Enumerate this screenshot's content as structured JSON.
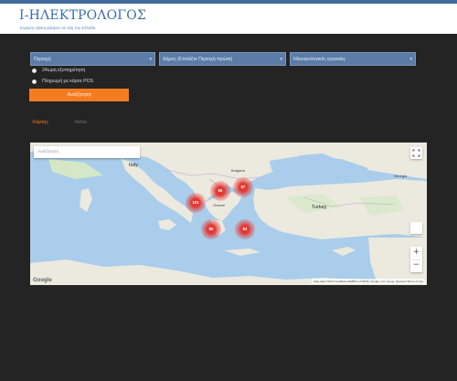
{
  "header": {
    "title": "I-ΗΛΕΚΤΡΟΛΟΓΟΣ",
    "subtitle": "Εύρεση ηλεκτρολόγου σε όλη την Ελλάδα"
  },
  "filters": [
    {
      "label": "Περιοχή"
    },
    {
      "label": "Δήμος (Επιλέξτε Περιοχή πρώτα)"
    },
    {
      "label": "Ηλεκτρολογικές εργασίες"
    }
  ],
  "options": [
    {
      "label": "24ωρη εξυπηρέτηση"
    },
    {
      "label": "Πληρωμή με κάρτα POS"
    }
  ],
  "search_button": "Αναζήτηση",
  "tabs": [
    {
      "label": "Χάρτης",
      "active": true
    },
    {
      "label": "Λίστα",
      "active": false
    }
  ],
  "map": {
    "search_placeholder": "Αναζήτηση",
    "google_logo": "Google",
    "attribution": "Map data ©2017 GeoBasis-DE/BKG (©2009), Google, Inst. Geogr. Nacional  Terms of Use",
    "zoom_in": "+",
    "zoom_out": "−",
    "labels": [
      "Italy",
      "Turkey",
      "Bulgaria",
      "Greece",
      "Georgia"
    ],
    "clusters": [
      "101",
      "86",
      "67",
      "95",
      "84"
    ]
  },
  "colors": {
    "accent": "#f47c20",
    "filter_bg": "#5a7ca6",
    "brand": "#3a6ea5",
    "page_bg": "#242424",
    "cluster": "#e53935"
  }
}
